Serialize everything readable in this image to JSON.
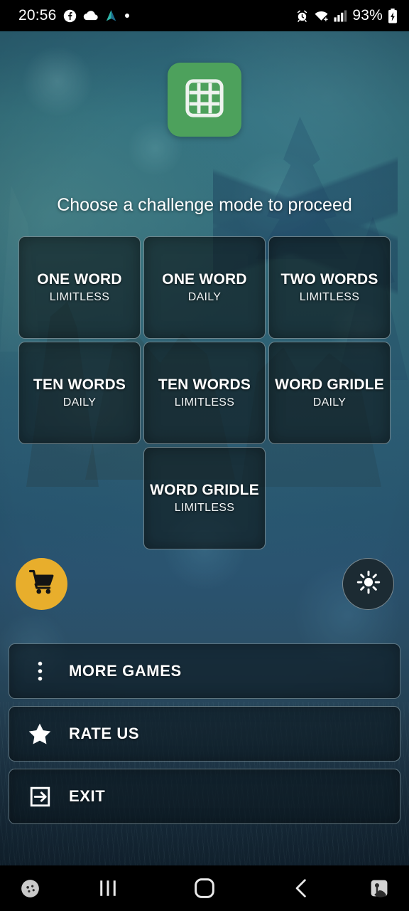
{
  "status_bar": {
    "clock": "20:56",
    "battery_percent": "93%",
    "left_icons": [
      "facebook-icon",
      "cloud-icon",
      "navigation-arrow-icon",
      "dot-icon"
    ],
    "right_icons": [
      "alarm-icon",
      "wifi-icon",
      "signal-bars-icon",
      "battery-charging-icon"
    ]
  },
  "app": {
    "logo_icon": "grid-3x3-icon",
    "logo_color": "#4da15c",
    "headline": "Choose a challenge mode to proceed"
  },
  "modes": [
    {
      "title": "ONE WORD",
      "subtitle": "LIMITLESS"
    },
    {
      "title": "ONE WORD",
      "subtitle": "DAILY"
    },
    {
      "title": "TWO WORDS",
      "subtitle": "LIMITLESS"
    },
    {
      "title": "TEN WORDS",
      "subtitle": "DAILY"
    },
    {
      "title": "TEN WORDS",
      "subtitle": "LIMITLESS"
    },
    {
      "title": "WORD GRIDLE",
      "subtitle": "DAILY"
    },
    {
      "title": "WORD GRIDLE",
      "subtitle": "LIMITLESS"
    }
  ],
  "circle_buttons": {
    "shop": {
      "icon": "shopping-cart-icon",
      "color": "#e8ae2c"
    },
    "brightness": {
      "icon": "sun-brightness-icon",
      "color": "#1c2b33"
    }
  },
  "menu": [
    {
      "label": "MORE GAMES",
      "icon": "kebab-menu-icon"
    },
    {
      "label": "RATE US",
      "icon": "star-icon"
    },
    {
      "label": "EXIT",
      "icon": "exit-arrow-icon"
    }
  ],
  "nav_bar": {
    "items": [
      "game-booster-icon",
      "recents-icon",
      "home-icon",
      "back-icon",
      "screen-capture-icon"
    ]
  }
}
